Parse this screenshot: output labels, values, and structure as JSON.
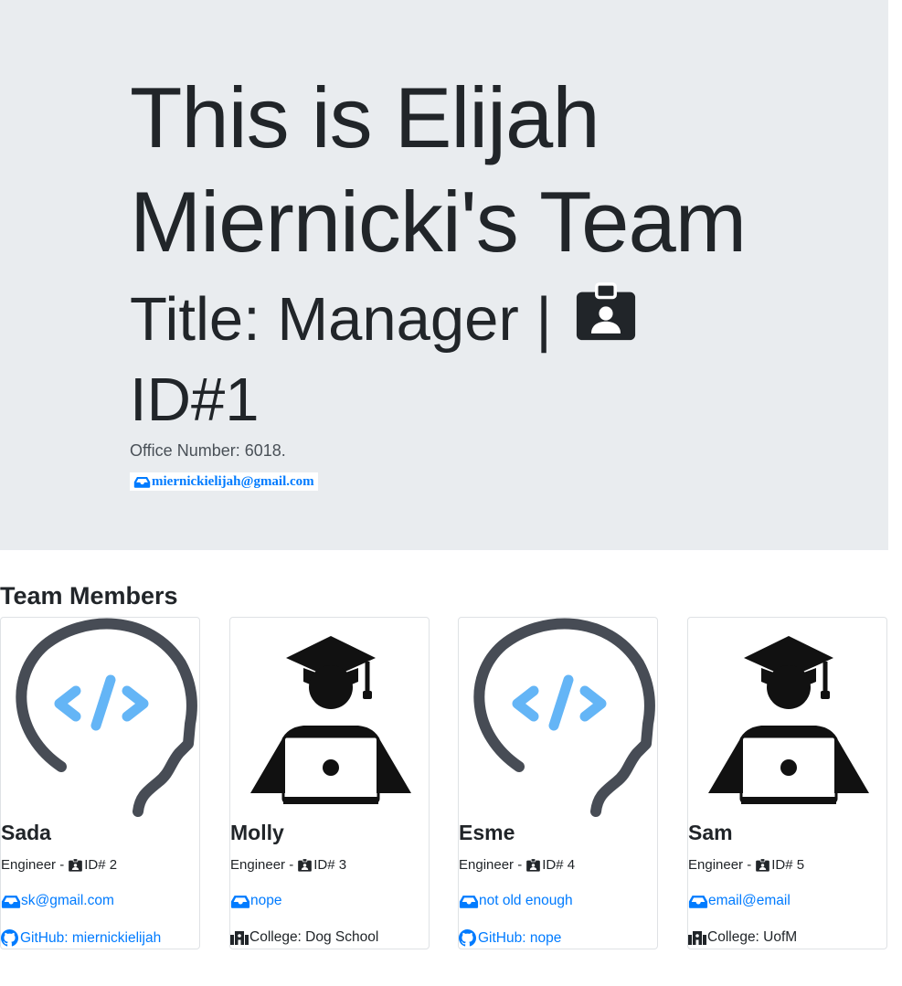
{
  "manager": {
    "heading": "This is Elijah Miernicki's Team",
    "title_label": "Title: Manager |",
    "id_label": "ID#1",
    "id_icon": "id-badge-icon",
    "office": "Office Number: 6018.",
    "email": "miernickielijah@gmail.com",
    "email_icon": "inbox-icon"
  },
  "team_title": "Team Members",
  "members": [
    {
      "name": "Sada",
      "role": "Engineer - ",
      "id": "ID# 2",
      "email": "sk@gmail.com",
      "extra": "GitHub: miernickielijah",
      "extra_icon": "github-icon",
      "image": "engineer-head-icon"
    },
    {
      "name": "Molly",
      "role": "Engineer - ",
      "id": "ID# 3",
      "email": "nope",
      "extra": "College: Dog School",
      "extra_icon": "school-icon",
      "image": "student-laptop-icon"
    },
    {
      "name": "Esme",
      "role": "Engineer - ",
      "id": "ID# 4",
      "email": "not old enough",
      "extra": "GitHub: nope",
      "extra_icon": "github-icon",
      "image": "engineer-head-icon"
    },
    {
      "name": "Sam",
      "role": "Engineer - ",
      "id": "ID# 5",
      "email": "email@email",
      "extra": "College: UofM",
      "extra_icon": "school-icon",
      "image": "student-laptop-icon"
    }
  ],
  "colors": {
    "link": "#007bff",
    "jumbotron_bg": "#e9ecef",
    "head_outline": "#474c55",
    "code_symbol": "#64b5f6"
  }
}
